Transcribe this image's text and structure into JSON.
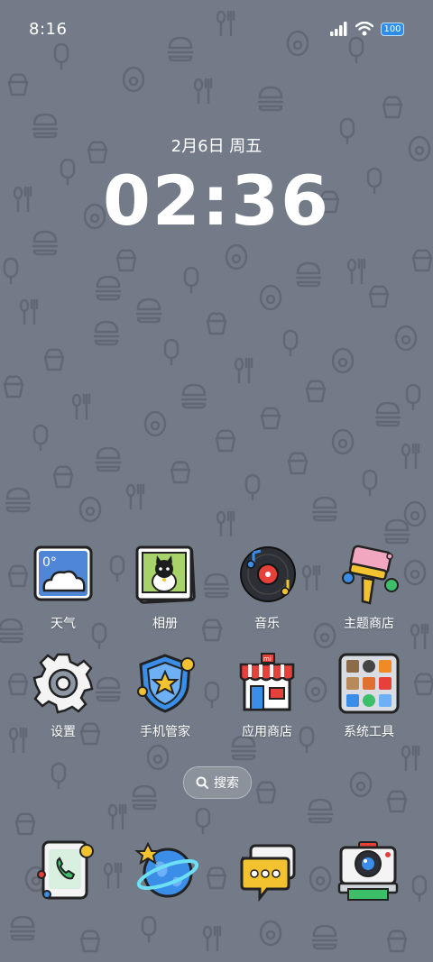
{
  "status_bar": {
    "time": "8:16",
    "battery": "100"
  },
  "lockscreen": {
    "date": "2月6日 周五",
    "time": "02:36"
  },
  "apps_row1": [
    {
      "label": "天气",
      "icon": "weather-icon",
      "temp": "0°"
    },
    {
      "label": "相册",
      "icon": "gallery-icon"
    },
    {
      "label": "音乐",
      "icon": "music-icon"
    },
    {
      "label": "主题商店",
      "icon": "theme-store-icon"
    }
  ],
  "apps_row2": [
    {
      "label": "设置",
      "icon": "settings-icon"
    },
    {
      "label": "手机管家",
      "icon": "security-icon"
    },
    {
      "label": "应用商店",
      "icon": "app-store-icon",
      "badge": "mi"
    },
    {
      "label": "系统工具",
      "icon": "system-tools-folder-icon"
    }
  ],
  "search": {
    "label": "搜索",
    "icon": "search-icon"
  },
  "dock": [
    {
      "name": "phone",
      "icon": "phone-icon"
    },
    {
      "name": "browser",
      "icon": "browser-planet-icon"
    },
    {
      "name": "messages",
      "icon": "messages-icon"
    },
    {
      "name": "camera",
      "icon": "camera-icon"
    }
  ],
  "colors": {
    "background": "#727b87",
    "battery": "#2e8de8"
  }
}
